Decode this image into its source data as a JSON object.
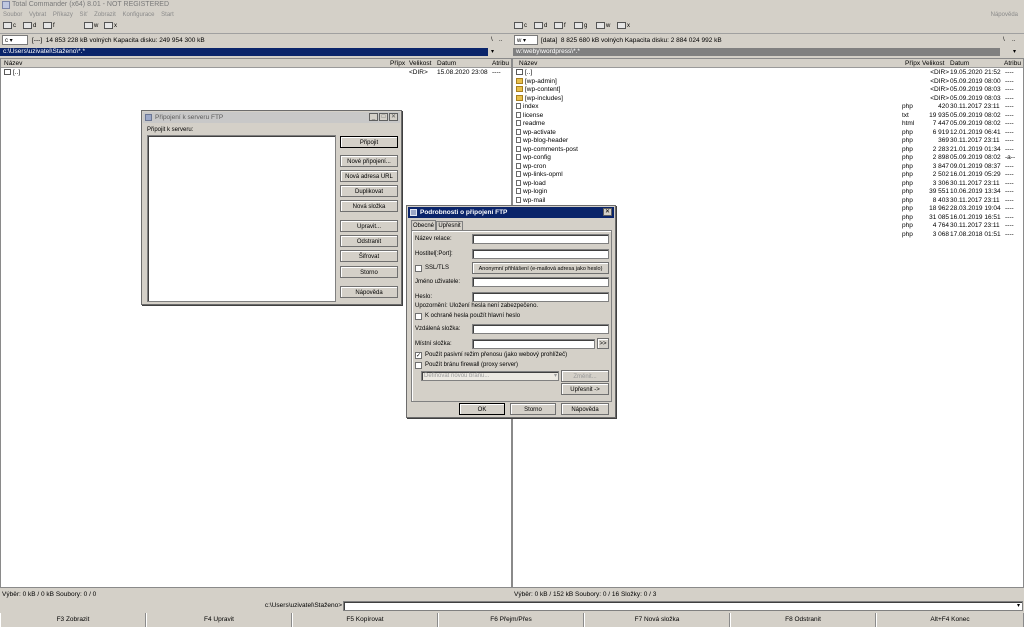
{
  "window": {
    "title": "Total Commander (x64) 8.01 - NOT REGISTERED",
    "help_menu": "Nápověda"
  },
  "menu": [
    "Soubor",
    "Vybrat",
    "Příkazy",
    "Síť",
    "Zobrazit",
    "Konfigurace",
    "Start"
  ],
  "toolbar": {
    "left_drives": [
      "c",
      "d",
      "f"
    ],
    "right_drives": [
      "c",
      "d",
      "f",
      "g"
    ],
    "net_drives": [
      "w",
      "x"
    ]
  },
  "left_panel": {
    "drive": "c",
    "drive_label": "[---]",
    "drive_info": "14 853 228 kB volných  Kapacita disku: 249 954 300 kB",
    "path": "c:\\Users\\uzivatel\\Staženo\\*.*",
    "headers": {
      "name": "Název",
      "ext": "Přípx",
      "size": "Velikost",
      "date": "Datum",
      "attr": "Atribu"
    },
    "files": [
      {
        "name": "[..]",
        "ext": "",
        "size": "<DIR>",
        "date": "15.08.2020 23:08",
        "attr": "----"
      }
    ],
    "status": "Výběr: 0 kB / 0 kB  Soubory: 0 / 0"
  },
  "right_panel": {
    "drive": "w",
    "drive_label": "[data]",
    "drive_info": "8 825 680 kB volných  Kapacita disku: 2 884 024 992 kB",
    "path": "w:\\weby\\wordpress\\*.*",
    "headers": {
      "name": "Název",
      "ext": "Přípx",
      "size": "Velikost",
      "date": "Datum",
      "attr": "Atribu"
    },
    "files": [
      {
        "name": "[..]",
        "ext": "",
        "size": "<DIR>",
        "date": "19.05.2020 21:52",
        "attr": "----",
        "type": "up"
      },
      {
        "name": "[wp-admin]",
        "ext": "",
        "size": "<DIR>",
        "date": "05.09.2019 08:00",
        "attr": "----",
        "type": "folder"
      },
      {
        "name": "[wp-content]",
        "ext": "",
        "size": "<DIR>",
        "date": "05.09.2019 08:03",
        "attr": "----",
        "type": "folder"
      },
      {
        "name": "[wp-includes]",
        "ext": "",
        "size": "<DIR>",
        "date": "05.09.2019 08:03",
        "attr": "----",
        "type": "folder"
      },
      {
        "name": "index",
        "ext": "php",
        "size": "420",
        "date": "30.11.2017 23:11",
        "attr": "----",
        "type": "file"
      },
      {
        "name": "license",
        "ext": "txt",
        "size": "19 935",
        "date": "05.09.2019 08:02",
        "attr": "----",
        "type": "file"
      },
      {
        "name": "readme",
        "ext": "html",
        "size": "7 447",
        "date": "05.09.2019 08:02",
        "attr": "----",
        "type": "file"
      },
      {
        "name": "wp-activate",
        "ext": "php",
        "size": "6 919",
        "date": "12.01.2019 06:41",
        "attr": "----",
        "type": "file"
      },
      {
        "name": "wp-blog-header",
        "ext": "php",
        "size": "369",
        "date": "30.11.2017 23:11",
        "attr": "----",
        "type": "file"
      },
      {
        "name": "wp-comments-post",
        "ext": "php",
        "size": "2 283",
        "date": "21.01.2019 01:34",
        "attr": "----",
        "type": "file"
      },
      {
        "name": "wp-config",
        "ext": "php",
        "size": "2 898",
        "date": "05.09.2019 08:02",
        "attr": "-a--",
        "type": "file"
      },
      {
        "name": "wp-cron",
        "ext": "php",
        "size": "3 847",
        "date": "09.01.2019 08:37",
        "attr": "----",
        "type": "file"
      },
      {
        "name": "wp-links-opml",
        "ext": "php",
        "size": "2 502",
        "date": "16.01.2019 05:29",
        "attr": "----",
        "type": "file"
      },
      {
        "name": "wp-load",
        "ext": "php",
        "size": "3 306",
        "date": "30.11.2017 23:11",
        "attr": "----",
        "type": "file"
      },
      {
        "name": "wp-login",
        "ext": "php",
        "size": "39 551",
        "date": "10.06.2019 13:34",
        "attr": "----",
        "type": "file"
      },
      {
        "name": "wp-mail",
        "ext": "php",
        "size": "8 403",
        "date": "30.11.2017 23:11",
        "attr": "----",
        "type": "file"
      },
      {
        "name": "",
        "ext": "php",
        "size": "18 962",
        "date": "28.03.2019 19:04",
        "attr": "----",
        "type": "file"
      },
      {
        "name": "",
        "ext": "php",
        "size": "31 085",
        "date": "16.01.2019 16:51",
        "attr": "----",
        "type": "file"
      },
      {
        "name": "",
        "ext": "php",
        "size": "4 764",
        "date": "30.11.2017 23:11",
        "attr": "----",
        "type": "file"
      },
      {
        "name": "",
        "ext": "php",
        "size": "3 068",
        "date": "17.08.2018 01:51",
        "attr": "----",
        "type": "file"
      }
    ],
    "status": "Výběr: 0 kB / 152 kB  Soubory: 0 / 16  Složky: 0 / 3"
  },
  "command_line": {
    "prompt": "c:\\Users\\uzivatel\\Staženo>",
    "value": ""
  },
  "fkeys": [
    "F3 Zobrazit",
    "F4 Upravit",
    "F5 Kopírovat",
    "F6 Přejm/Přes",
    "F7 Nová složka",
    "F8 Odstranit",
    "Alt+F4 Konec"
  ],
  "ftp_connect_dialog": {
    "title": "Připojení k serveru FTP",
    "label": "Připojit k serveru:",
    "buttons": [
      "Připojit",
      "Nové připojení...",
      "Nová adresa URL",
      "Duplikovat",
      "Nová složka",
      "Upravit...",
      "Odstranit",
      "Šifrovat",
      "Storno",
      "Nápověda"
    ]
  },
  "ftp_details_dialog": {
    "title": "Podrobnosti o připojení FTP",
    "tabs": [
      "Obecné",
      "Upřesnit"
    ],
    "session_label": "Název relace:",
    "host_label": "Hostitel[:Port]:",
    "ssl_label": "SSL/TLS",
    "anon_button": "Anonymní přihlášení (e-mailová adresa jako heslo)",
    "user_label": "Jméno uživatele:",
    "password_label": "Heslo:",
    "warning": "Upozornění: Uložení hesla není zabezpečeno.",
    "master_password_label": "K ochraně hesla použít hlavní heslo",
    "remote_folder_label": "Vzdálená složka:",
    "local_folder_label": "Místní složka:",
    "browse_button": ">>",
    "passive_label": "Použít pasivní režim přenosu (jako webový prohlížeč)",
    "firewall_label": "Použít bránu firewall (proxy server)",
    "firewall_placeholder": "Definovat novou bránu...",
    "change_button": "Změnit...",
    "advanced_button": "Upřesnit ->",
    "ok": "OK",
    "cancel": "Storno",
    "help": "Nápověda",
    "passive_checked": true,
    "ssl_checked": false
  }
}
